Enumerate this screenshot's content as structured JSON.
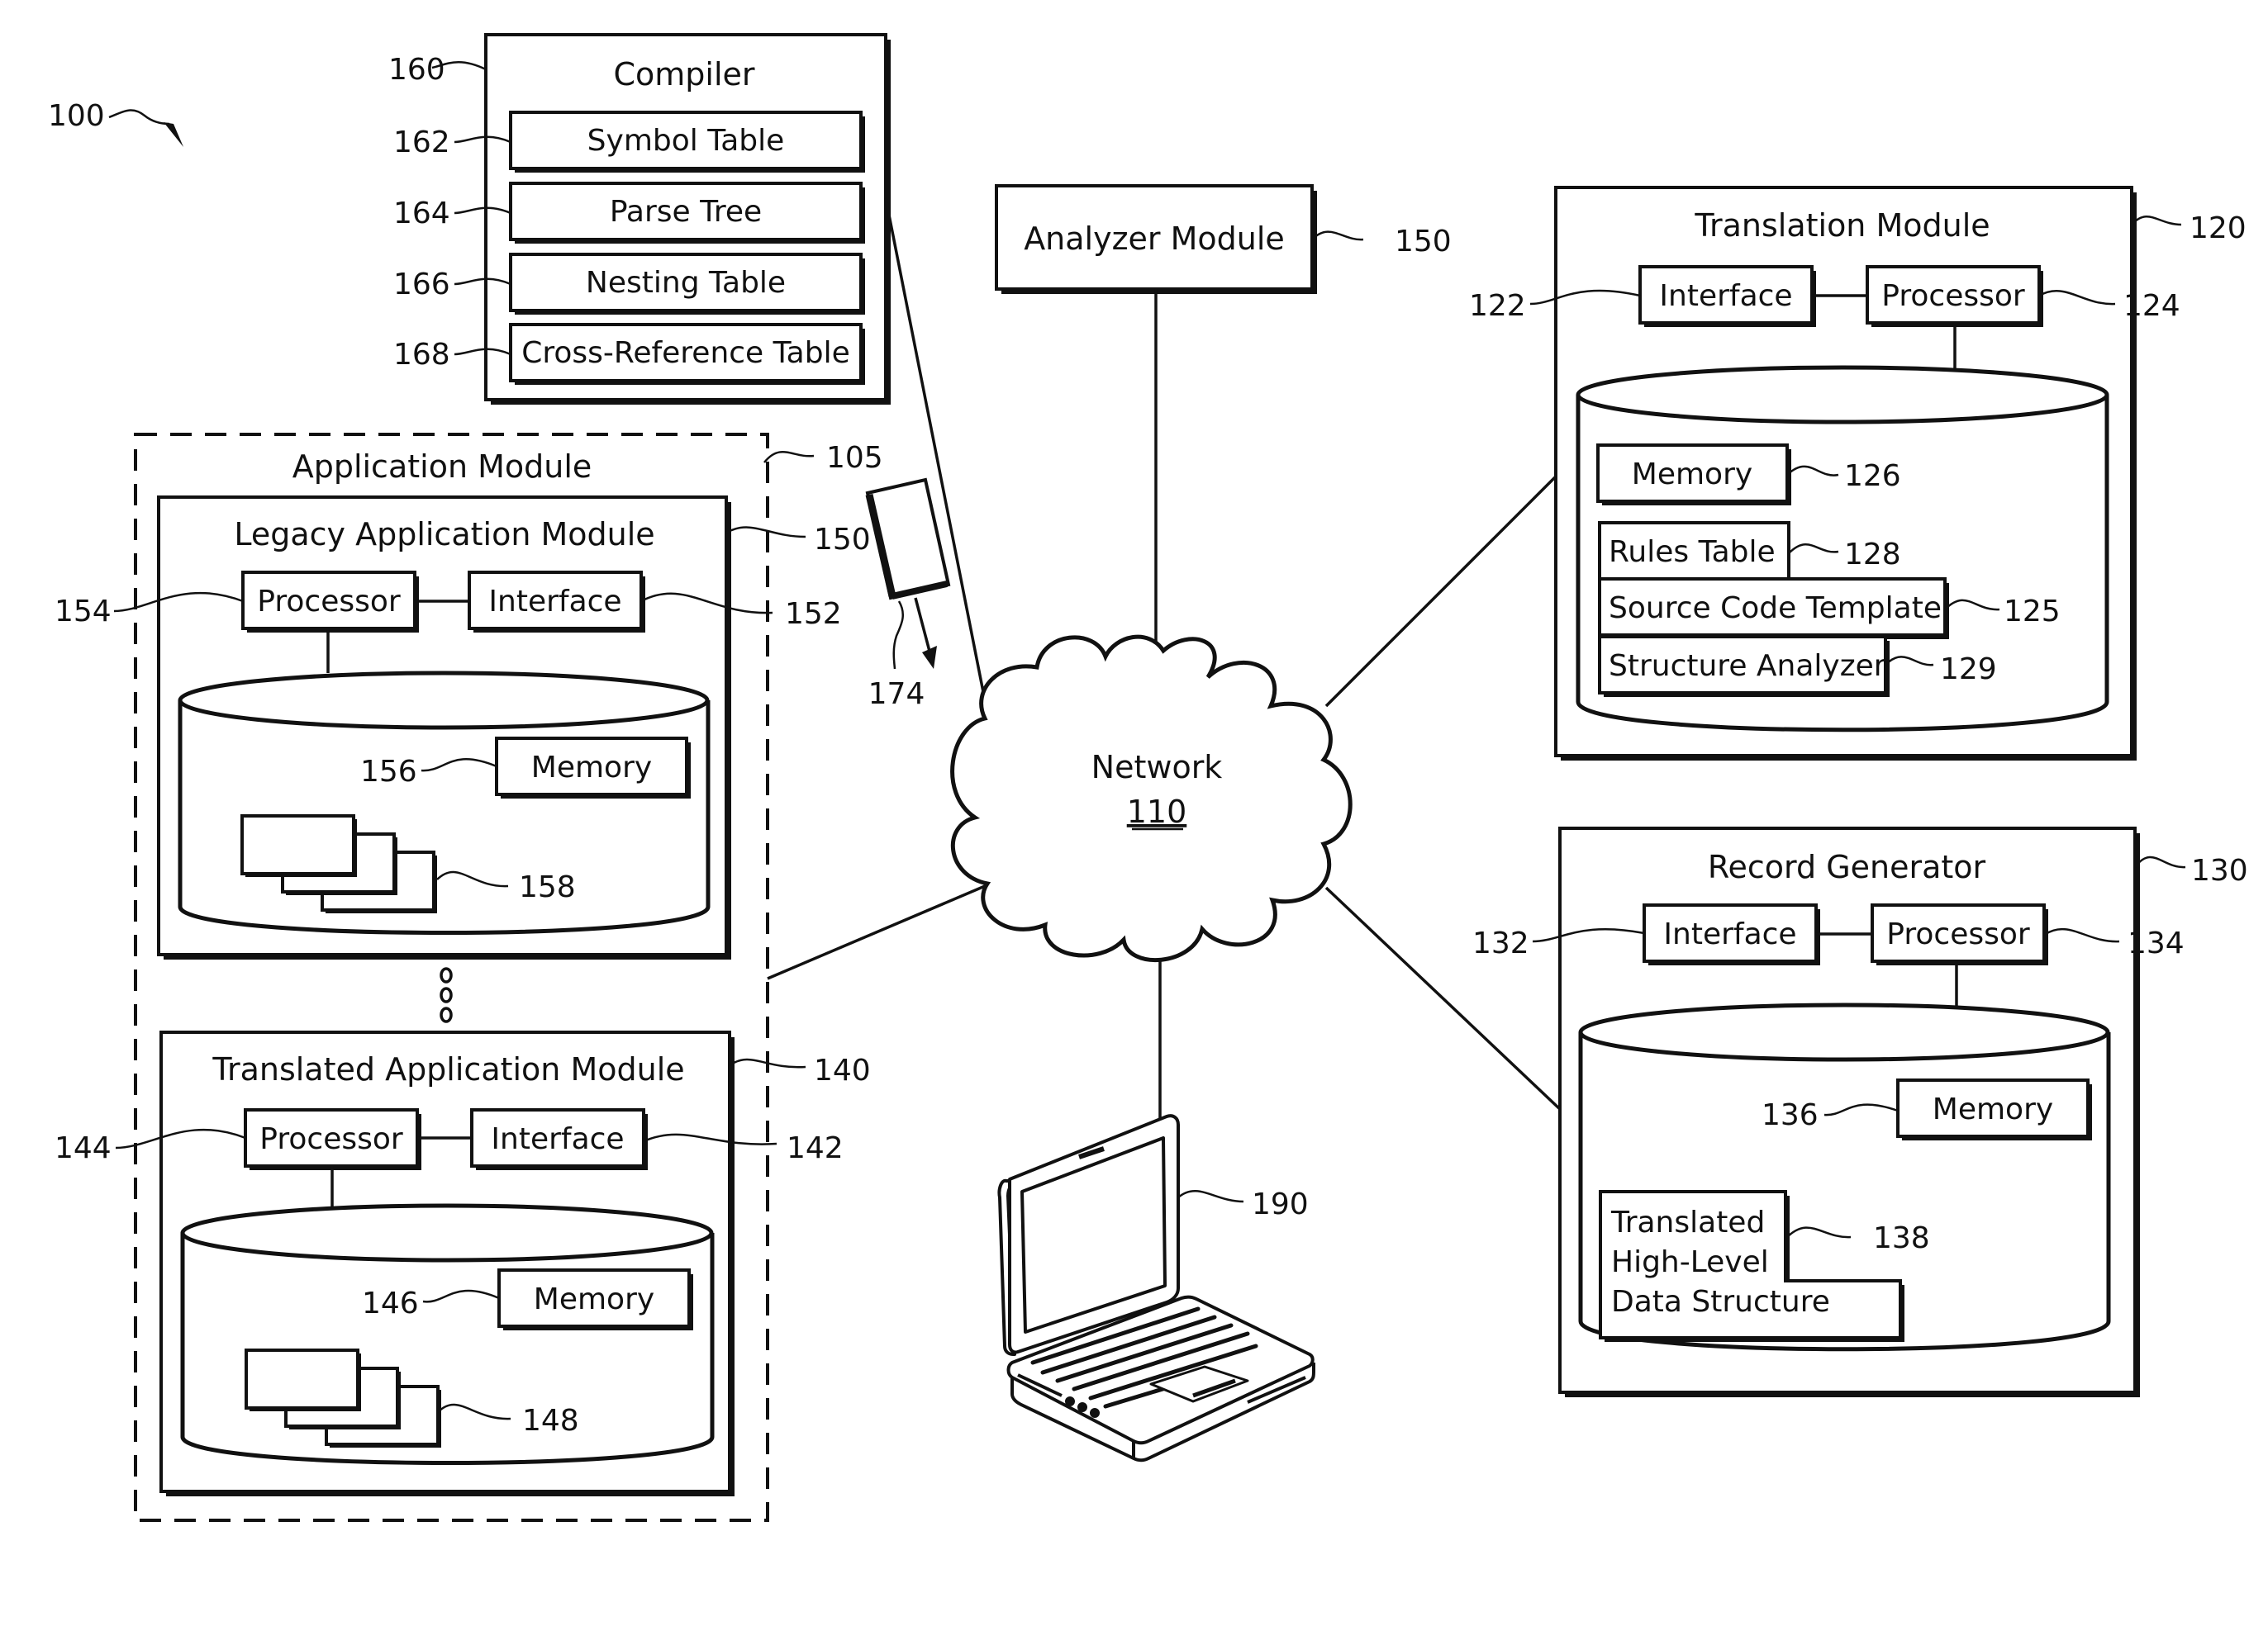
{
  "figure": {
    "system_ref": "100",
    "compiler": {
      "ref": "160",
      "title": "Compiler",
      "items": [
        {
          "ref": "162",
          "label": "Symbol Table"
        },
        {
          "ref": "164",
          "label": "Parse Tree"
        },
        {
          "ref": "166",
          "label": "Nesting Table"
        },
        {
          "ref": "168",
          "label": "Cross-Reference Table"
        }
      ]
    },
    "analyzer": {
      "ref": "150",
      "title": "Analyzer Module"
    },
    "translation_module": {
      "ref": "120",
      "title": "Translation Module",
      "interface": {
        "ref": "122",
        "label": "Interface"
      },
      "processor": {
        "ref": "124",
        "label": "Processor"
      },
      "memory": {
        "ref": "126",
        "label": "Memory"
      },
      "rules_table": {
        "ref": "128",
        "label": "Rules Table"
      },
      "source_code_template": {
        "ref": "125",
        "label": "Source Code Template"
      },
      "structure_analyzer": {
        "ref": "129",
        "label": "Structure Analyzer"
      }
    },
    "application_module": {
      "ref": "105",
      "title": "Application Module",
      "legacy": {
        "ref": "150",
        "title": "Legacy Application Module",
        "processor": {
          "ref": "154",
          "label": "Processor"
        },
        "interface": {
          "ref": "152",
          "label": "Interface"
        },
        "memory": {
          "ref": "156",
          "label": "Memory"
        },
        "records_ref": "158"
      },
      "translated": {
        "ref": "140",
        "title": "Translated Application Module",
        "processor": {
          "ref": "144",
          "label": "Processor"
        },
        "interface": {
          "ref": "142",
          "label": "Interface"
        },
        "memory": {
          "ref": "146",
          "label": "Memory"
        },
        "records_ref": "148"
      }
    },
    "storage_device": {
      "ref": "174"
    },
    "network": {
      "title": "Network",
      "ref": "110"
    },
    "record_generator": {
      "ref": "130",
      "title": "Record Generator",
      "interface": {
        "ref": "132",
        "label": "Interface"
      },
      "processor": {
        "ref": "134",
        "label": "Processor"
      },
      "memory": {
        "ref": "136",
        "label": "Memory"
      },
      "data_structure": {
        "ref": "138",
        "lines": [
          "Translated",
          "High-Level",
          "Data Structure"
        ]
      }
    },
    "laptop": {
      "ref": "190"
    }
  }
}
